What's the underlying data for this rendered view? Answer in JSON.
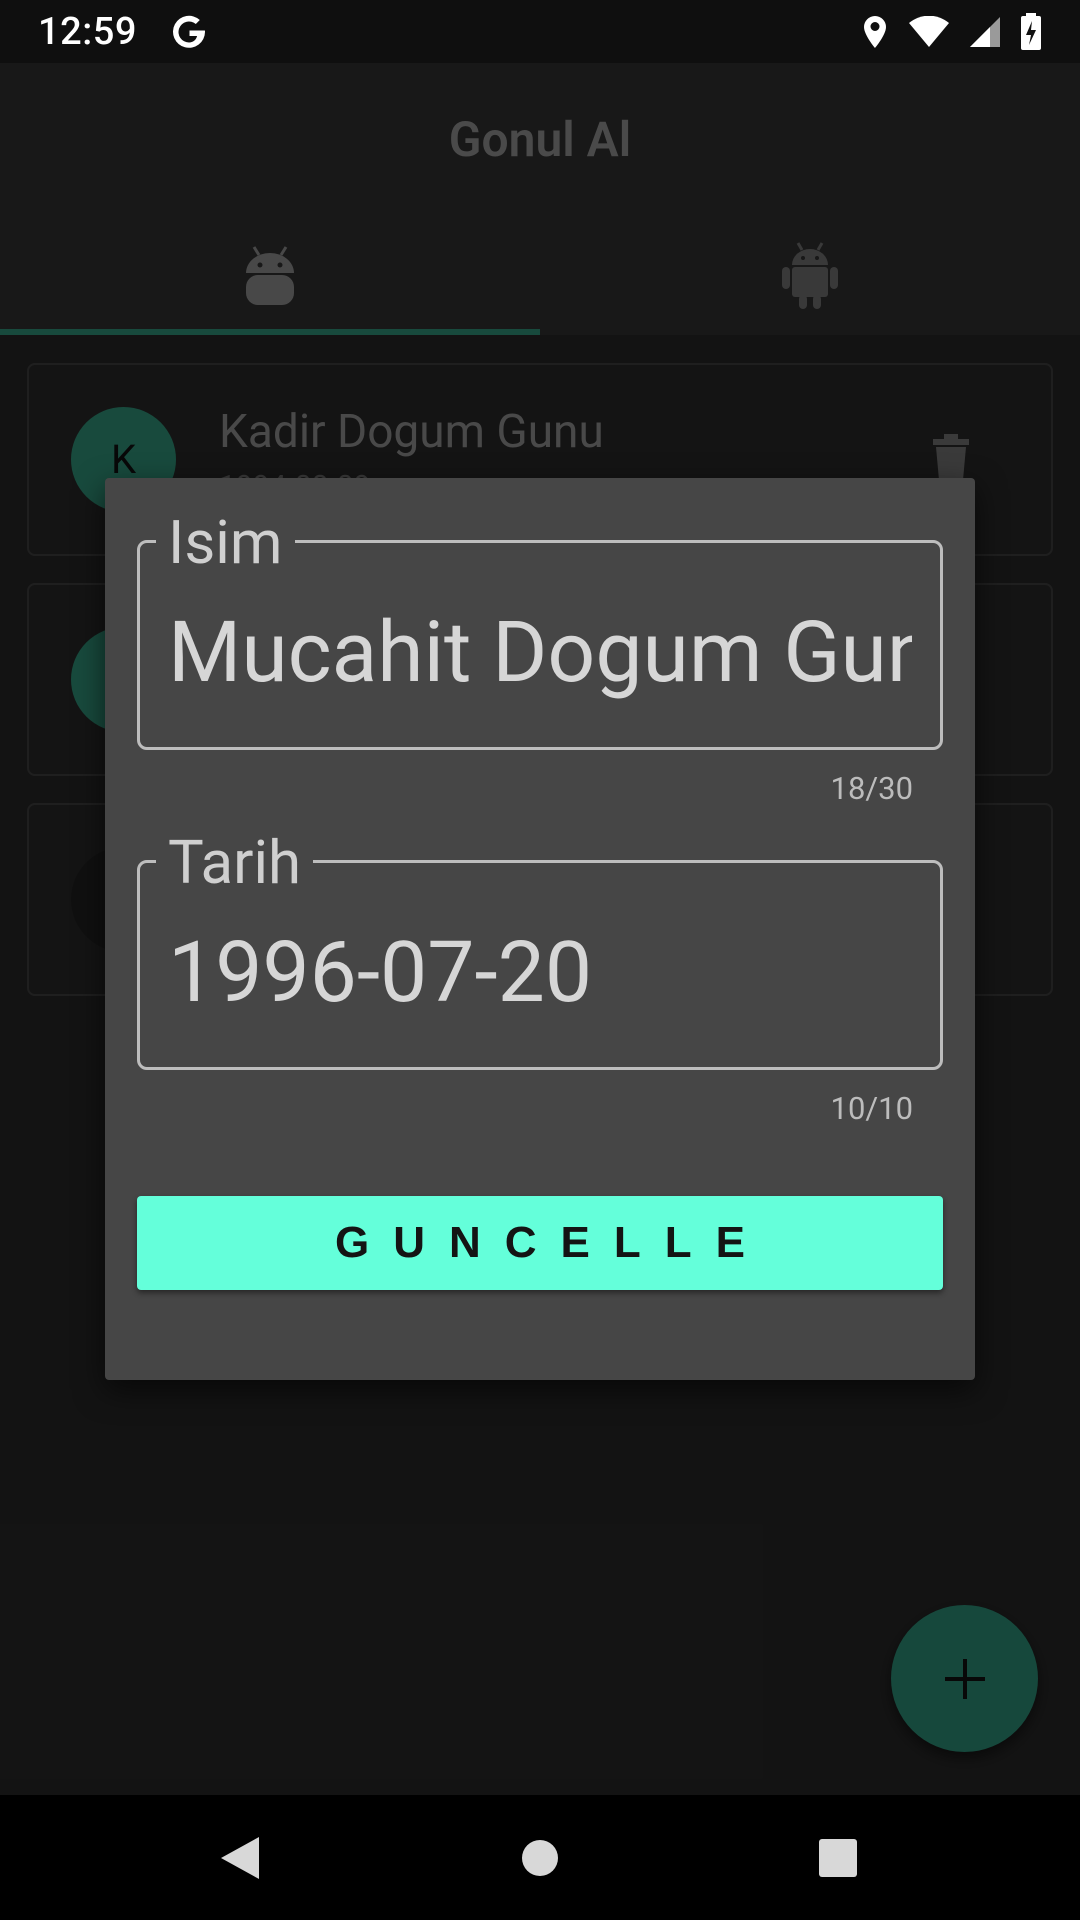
{
  "status_bar": {
    "time": "12:59",
    "icons": [
      "google-icon",
      "location-icon",
      "wifi-icon",
      "signal-icon",
      "battery-charging-icon"
    ]
  },
  "app_bar": {
    "title": "Gonul Al",
    "tabs": [
      {
        "icon": "android-head-icon",
        "selected": true
      },
      {
        "icon": "android-robot-icon",
        "selected": false
      }
    ],
    "accent_color": "#2e8f76"
  },
  "list": {
    "items": [
      {
        "avatar_letter": "K",
        "title": "Kadir Dogum Gunu",
        "subtitle": "1994-08-09"
      },
      {
        "avatar_letter": "",
        "title": "",
        "subtitle": ""
      },
      {
        "avatar_letter": "",
        "title": "",
        "subtitle": ""
      }
    ]
  },
  "dialog": {
    "name_field": {
      "label": "Isim",
      "value": "Mucahit Dogum Gunu",
      "counter": "18/30"
    },
    "date_field": {
      "label": "Tarih",
      "value": "1996-07-20",
      "counter": "10/10"
    },
    "update_button_label": "GUNCELLE",
    "button_color": "#64ffda"
  },
  "fab": {
    "icon": "plus-icon"
  },
  "nav_bar": {
    "buttons": [
      "back-icon",
      "home-icon",
      "recents-icon"
    ]
  }
}
